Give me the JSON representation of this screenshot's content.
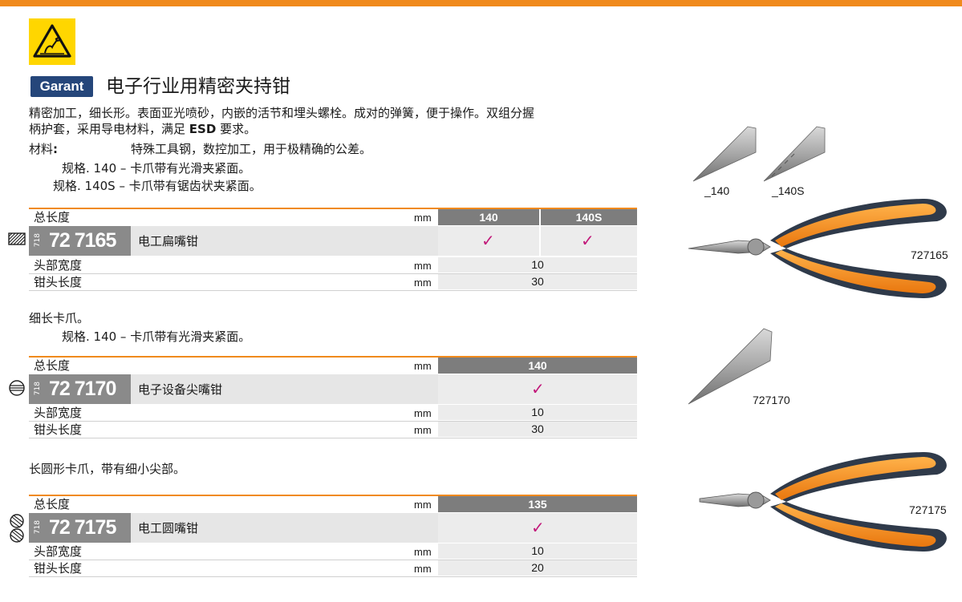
{
  "header": {
    "esd_icon": "esd-warning-icon",
    "brand": "Garant",
    "title": "电子行业用精密夹持钳",
    "intro_line1": "精密加工，细长形。表面亚光喷砂，内嵌的活节和埋头螺栓。成对的弹簧，便于操作。双组分握",
    "intro_line2_a": "柄护套，采用导电材料，满足",
    "intro_line2_esd": "ESD",
    "intro_line2_b": "要求。",
    "material_label": "材料",
    "material_colon": ":",
    "material_text": "特殊工具钢，数控加工，用于极精确的公差。",
    "spec1": "规格. 140 –  卡爪带有光滑夹紧面。",
    "spec2": "规格. 140S –  卡爪带有锯齿状夹紧面。"
  },
  "tables": [
    {
      "overall_label": "总长度",
      "unit": "mm",
      "variants": [
        "140",
        "140S"
      ],
      "prefix": "718",
      "code": "72 7165",
      "name": "电工扁嘴钳",
      "checks": [
        "✓",
        "✓"
      ],
      "rows": [
        {
          "label": "头部宽度",
          "unit": "mm",
          "value": "10"
        },
        {
          "label": "钳头长度",
          "unit": "mm",
          "value": "30"
        }
      ]
    },
    {
      "overall_label": "总长度",
      "unit": "mm",
      "variants": [
        "140"
      ],
      "prefix": "718",
      "code": "72 7170",
      "name": "电子设备尖嘴钳",
      "checks": [
        "✓"
      ],
      "rows": [
        {
          "label": "头部宽度",
          "unit": "mm",
          "value": "10"
        },
        {
          "label": "钳头长度",
          "unit": "mm",
          "value": "30"
        }
      ]
    },
    {
      "overall_label": "总长度",
      "unit": "mm",
      "variants": [
        "135"
      ],
      "prefix": "718",
      "code": "72 7175",
      "name": "电工圆嘴钳",
      "checks": [
        "✓"
      ],
      "rows": [
        {
          "label": "头部宽度",
          "unit": "mm",
          "value": "10"
        },
        {
          "label": "钳头长度",
          "unit": "mm",
          "value": "20"
        }
      ]
    }
  ],
  "section2": {
    "desc": "细长卡爪。",
    "spec": "规格. 140 –  卡爪带有光滑夹紧面。"
  },
  "section3": {
    "desc": "长圆形卡爪，带有细小尖部。"
  },
  "images": {
    "tip1_label": "_140",
    "tip2_label": "_140S",
    "p1_label": "727165",
    "p2_label": "727170",
    "p3_label": "727175"
  },
  "colors": {
    "accent": "#f08a1c",
    "brand": "#25467a",
    "check": "#c2187a",
    "esd": "#ffd600"
  }
}
